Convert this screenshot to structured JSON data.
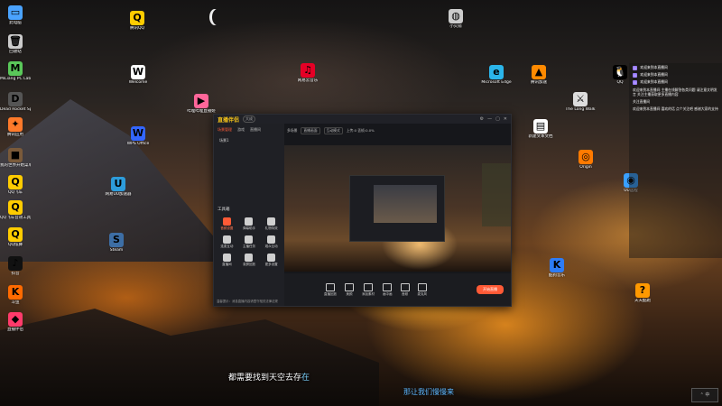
{
  "desktop": {
    "icons": [
      {
        "label": "此电脑",
        "glyph": "▭",
        "color": "#4aa3ff"
      },
      {
        "label": "回收站",
        "glyph": "🗑",
        "color": "#cccccc"
      },
      {
        "label": "MiLiang PC Lab",
        "glyph": "M",
        "color": "#5ac85a"
      },
      {
        "label": "Dead Rocket Space",
        "glyph": "D",
        "color": "#555555"
      },
      {
        "label": "腾讯应用",
        "glyph": "✦",
        "color": "#ff7a2a"
      },
      {
        "label": "我的世界开始菜单",
        "glyph": "■",
        "color": "#7a5a3a"
      },
      {
        "label": "QQ飞车",
        "glyph": "Q",
        "color": "#ffcc00"
      },
      {
        "label": "QQ飞车音效工具",
        "glyph": "Q",
        "color": "#ffcc00"
      },
      {
        "label": "QQ炫舞",
        "glyph": "Q",
        "color": "#ffcc00"
      },
      {
        "label": "抖音",
        "glyph": "♪",
        "color": "#111111"
      },
      {
        "label": "斗鱼",
        "glyph": "K",
        "color": "#ff6a00"
      },
      {
        "label": "直播伴侣",
        "glyph": "◆",
        "color": "#ff3b6b"
      },
      {
        "label": "Welcome",
        "glyph": "W",
        "color": "#ffffff"
      },
      {
        "label": "腾讯QQ",
        "glyph": "Q",
        "color": "#ffcc00"
      },
      {
        "label": "WPS Office",
        "glyph": "W",
        "color": "#3366ff"
      },
      {
        "label": "网易云音乐",
        "glyph": "♫",
        "color": "#e60026"
      },
      {
        "label": "哔哩哔哩直播姬",
        "glyph": "▶",
        "color": "#ff6699"
      },
      {
        "label": "Steam",
        "glyph": "S",
        "color": "#3d6ea5"
      },
      {
        "label": "网易UU加速器",
        "glyph": "U",
        "color": "#2d9cdb"
      },
      {
        "label": "Microsoft Edge",
        "glyph": "e",
        "color": "#2bb5ea"
      },
      {
        "label": "腾讯加速",
        "glyph": "▲",
        "color": "#ff8a00"
      },
      {
        "label": "QQ",
        "glyph": "🐧",
        "color": "#000000"
      },
      {
        "label": "The Long Walk",
        "glyph": "⚔",
        "color": "#dddddd"
      },
      {
        "label": "Origin",
        "glyph": "◎",
        "color": "#ff7a00"
      },
      {
        "label": "酷狗音乐",
        "glyph": "K",
        "color": "#2d7cf6"
      },
      {
        "label": "天天酷跑",
        "glyph": "?",
        "color": "#ff9900"
      },
      {
        "label": "新建文本文档",
        "glyph": "▤",
        "color": "#ffffff"
      },
      {
        "label": "小火箭",
        "glyph": "◍",
        "color": "#cccccc"
      },
      {
        "label": "UU远程",
        "glyph": "◉",
        "color": "#3aa0ff"
      }
    ]
  },
  "app": {
    "logo": "直播伴侣",
    "version": "大成",
    "tabs": [
      "场景管理",
      "游戏",
      "直播间"
    ],
    "scene_label": "场景1",
    "toolbar": {
      "mode": "多场景",
      "chip1": "直播画面",
      "chip2": "互动模式",
      "info": "上传:0 丢帧:0.0%"
    },
    "tools_title": "工具箱",
    "tools": [
      "音频设置",
      "弹幕助手",
      "礼物特效",
      "连麦互动",
      "主播任务",
      "观众互动",
      "直播间",
      "录屏回放",
      "更多设置"
    ],
    "notice": "温馨提示：消息直播内容请遵守相关法律法规",
    "bottom_actions": [
      "直播回放",
      "美颜",
      "添加素材",
      "画中画",
      "音频",
      "麦克风"
    ],
    "go_live": "开始直播"
  },
  "chat": {
    "messages": [
      {
        "badge": "☆",
        "name": "欢迎来到本直播间"
      },
      {
        "badge": "☆",
        "name": "欢迎来到本直播间"
      },
      {
        "badge": "☆",
        "name": "欢迎来到本直播间"
      }
    ],
    "notice": "欢迎来到本直播间 主播在线解答各类问题 请注意文明发言 关注主播获取更多直播内容",
    "follow": "关注直播间",
    "footer": "欢迎来到本直播间 喜欢的话 点个关注吧 感谢大家的支持"
  },
  "subtitles": {
    "line1_main": "都需要找到天空去存",
    "line1_highlight": "在",
    "line2": "那让我们慢慢来"
  },
  "taskbar": {
    "tray": "⌃ 中"
  }
}
